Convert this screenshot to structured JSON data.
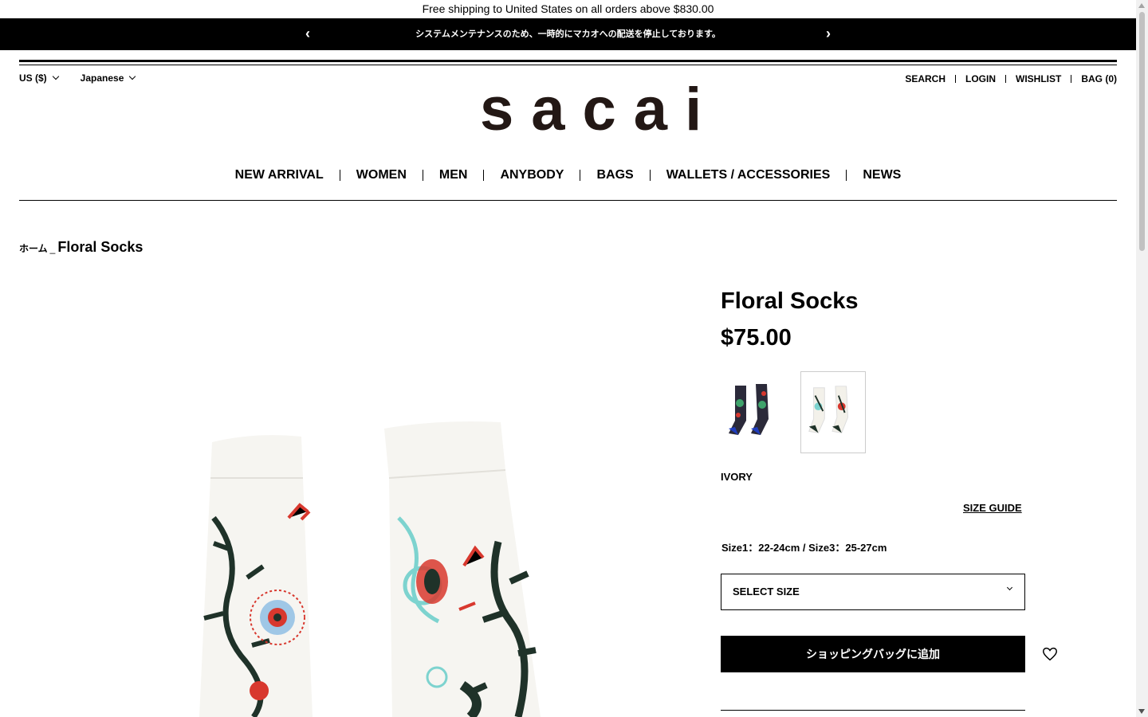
{
  "announcement": {
    "shipping_text": "Free shipping to United States on all orders above $830.00",
    "notice_text": "システムメンテナンスのため、一時的にマカオへの配送を停止しております。",
    "prev_icon": "chevron-left-icon",
    "next_icon": "chevron-right-icon"
  },
  "utility": {
    "currency": "US ($)",
    "language": "Japanese",
    "links": [
      "SEARCH",
      "LOGIN",
      "WISHLIST",
      "BAG (0)"
    ]
  },
  "brand": {
    "logo_text": "sacai",
    "logo_color": "#231815"
  },
  "nav": {
    "items": [
      "NEW ARRIVAL",
      "WOMEN",
      "MEN",
      "ANYBODY",
      "BAGS",
      "WALLETS / ACCESSORIES",
      "NEWS"
    ]
  },
  "breadcrumb": {
    "home": "ホーム",
    "separator": "_",
    "current": "Floral Socks"
  },
  "product": {
    "title": "Floral Socks",
    "price": "$75.00",
    "swatches": [
      {
        "color": "navy",
        "icon": "sock-swatch-navy"
      },
      {
        "color": "ivory",
        "icon": "sock-swatch-ivory",
        "selected": true
      }
    ],
    "selected_color": "IVORY",
    "size_guide_label": "SIZE GUIDE",
    "size_info": "Size1：22-24cm / Size3：25-27cm",
    "size_select_label": "SELECT SIZE",
    "add_to_bag_label": "ショッピングバッグに追加",
    "wishlist_icon": "heart-icon"
  }
}
